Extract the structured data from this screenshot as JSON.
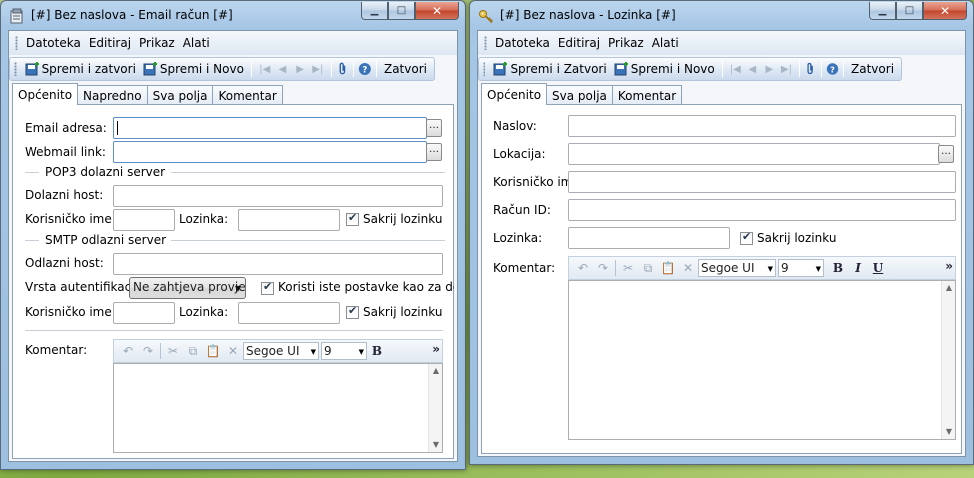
{
  "windows": {
    "email": {
      "title": "[#] Bez naslova - Email račun [#]",
      "menu": [
        "Datoteka",
        "Editiraj",
        "Prikaz",
        "Alati"
      ],
      "toolbar": {
        "save_close": "Spremi i zatvori",
        "save_new": "Spremi i Novo",
        "close": "Zatvori"
      },
      "tabs": [
        "Općenito",
        "Napredno",
        "Sva polja",
        "Komentar"
      ],
      "active_tab": "Općenito",
      "fields": {
        "email_label": "Email adresa:",
        "webmail_label": "Webmail link:",
        "pop3_group": "POP3 dolazni server",
        "incoming_host_label": "Dolazni host:",
        "pop3_user_label": "Korisničko ime:",
        "pop3_password_label": "Lozinka:",
        "pop3_hide_password": "Sakrij lozinku",
        "smtp_group": "SMTP odlazni server",
        "outgoing_host_label": "Odlazni host:",
        "auth_label": "Vrsta autentifikacije:",
        "auth_value": "Ne zahtjeva provjeru",
        "same_settings": "Koristi iste postavke kao za dolazni server",
        "smtp_user_label": "Korisničko ime:",
        "smtp_password_label": "Lozinka:",
        "smtp_hide_password": "Sakrij lozinku",
        "comment_label": "Komentar:"
      },
      "editor": {
        "font": "Segoe UI",
        "size": "9"
      }
    },
    "password": {
      "title": "[#] Bez naslova - Lozinka [#]",
      "menu": [
        "Datoteka",
        "Editiraj",
        "Prikaz",
        "Alati"
      ],
      "toolbar": {
        "save_close": "Spremi i Zatvori",
        "save_new": "Spremi i Novo",
        "close": "Zatvori"
      },
      "tabs": [
        "Općenito",
        "Sva polja",
        "Komentar"
      ],
      "active_tab": "Općenito",
      "fields": {
        "title_label": "Naslov:",
        "location_label": "Lokacija:",
        "username_label": "Korisničko ime:",
        "account_label": "Račun ID:",
        "password_label": "Lozinka:",
        "hide_password": "Sakrij lozinku",
        "comment_label": "Komentar:"
      },
      "editor": {
        "font": "Segoe UI",
        "size": "9"
      }
    }
  },
  "colors": {
    "accent": "#3b73b9",
    "window_frame": "#a6c6e6",
    "close_button": "#c4442c"
  }
}
